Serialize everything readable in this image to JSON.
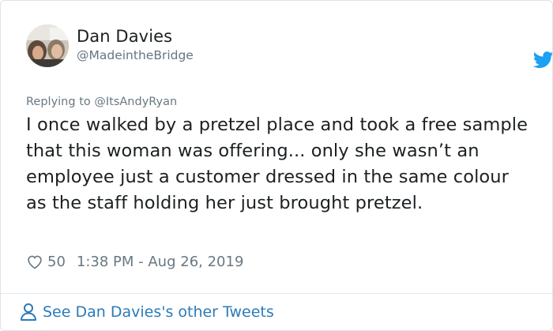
{
  "author": {
    "name": "Dan Davies",
    "handle": "@MadeintheBridge"
  },
  "reply": {
    "prefix": "Replying to ",
    "mention": "@ItsAndyRyan"
  },
  "tweet": {
    "text": "I once walked by a pretzel place and took a free sample that this woman was offering... only she wasn’t an employee just a customer dressed in the same colour as the staff holding her just brought pretzel."
  },
  "meta": {
    "likes": "50",
    "timestamp": "1:38 PM - Aug 26, 2019"
  },
  "footer": {
    "link": "See Dan Davies's other Tweets"
  },
  "icons": {
    "brand": "twitter-bird-icon",
    "like": "heart-icon",
    "profile": "person-icon"
  },
  "colors": {
    "brand": "#1da1f2",
    "link": "#2b7bb9",
    "muted": "#697882",
    "text": "#1c2022"
  }
}
